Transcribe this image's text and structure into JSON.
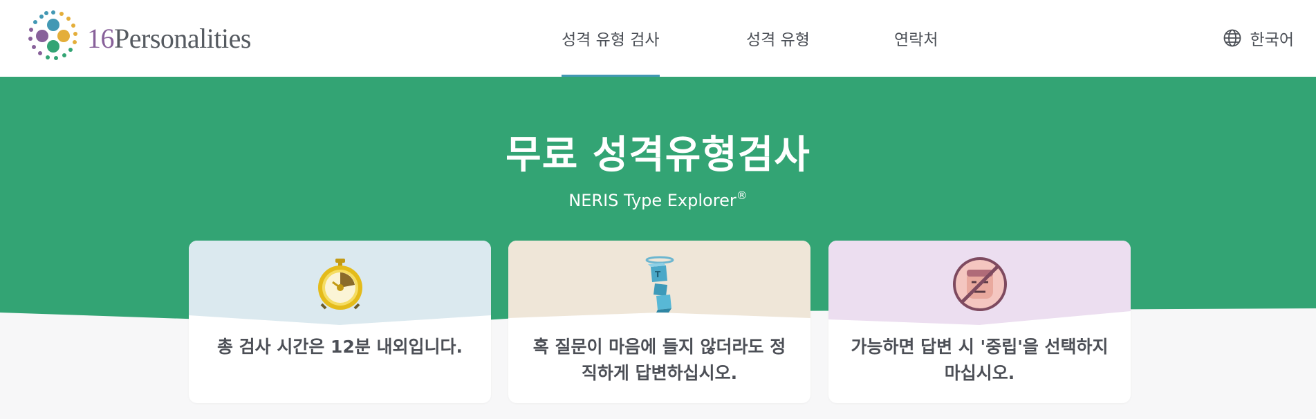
{
  "header": {
    "logo": {
      "number": "16",
      "word": "Personalities"
    },
    "nav": [
      {
        "label": "성격 유형 검사",
        "active": true
      },
      {
        "label": "성격 유형",
        "active": false
      },
      {
        "label": "연락처",
        "active": false
      }
    ],
    "language": {
      "label": "한국어",
      "icon": "globe-icon"
    }
  },
  "hero": {
    "title": "무료 성격유형검사",
    "subtitle": "NERIS Type Explorer",
    "subtitle_mark": "®"
  },
  "cards": [
    {
      "text": "총 검사 시간은 12분 내외입니다.",
      "icon": "stopwatch-icon",
      "color": "#dbe9ef"
    },
    {
      "text": "혹 질문이 마음에 들지 않더라도 정직하게 답변하십시오.",
      "icon": "angel-blocks-icon",
      "color": "#efe6d8"
    },
    {
      "text": "가능하면 답변 시 '중립'을 선택하지 마십시오.",
      "icon": "no-neutral-face-icon",
      "color": "#ecdef0"
    }
  ],
  "colors": {
    "accent": "#33a474",
    "nav_underline": "#4298b4",
    "logo_purple": "#88619a"
  }
}
